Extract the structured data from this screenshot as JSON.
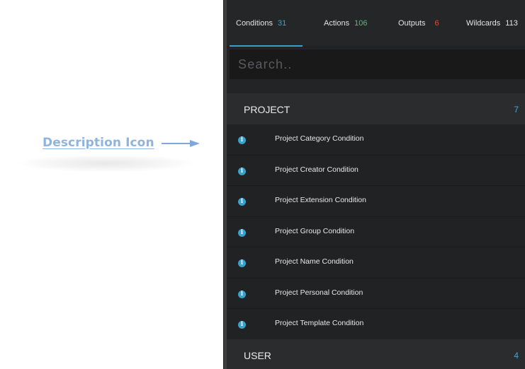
{
  "annotation": {
    "label": "Description Icon",
    "color": "#8fb4de"
  },
  "tabs": [
    {
      "label": "Conditions",
      "count": "31",
      "count_color": "#3aa0cc"
    },
    {
      "label": "Actions",
      "count": "106",
      "count_color": "#46c37b"
    },
    {
      "label": "Outputs",
      "count": "6",
      "count_color": "#e04b3c"
    },
    {
      "label": "Wildcards",
      "count": "113",
      "count_color": "#e4e4e4"
    }
  ],
  "search": {
    "placeholder": "Search.."
  },
  "groups": [
    {
      "title": "PROJECT",
      "count": "7",
      "items": [
        {
          "label": "Project Category Condition",
          "icon": "info-icon"
        },
        {
          "label": "Project Creator Condition",
          "icon": "info-icon"
        },
        {
          "label": "Project Extension Condition",
          "icon": "info-icon"
        },
        {
          "label": "Project Group Condition",
          "icon": "info-icon"
        },
        {
          "label": "Project Name Condition",
          "icon": "info-icon"
        },
        {
          "label": "Project Personal Condition",
          "icon": "info-icon"
        },
        {
          "label": "Project Template Condition",
          "icon": "info-icon"
        }
      ]
    },
    {
      "title": "USER",
      "count": "4",
      "items": []
    }
  ],
  "colors": {
    "accent": "#3aa0cc",
    "panel_bg": "#232425"
  }
}
